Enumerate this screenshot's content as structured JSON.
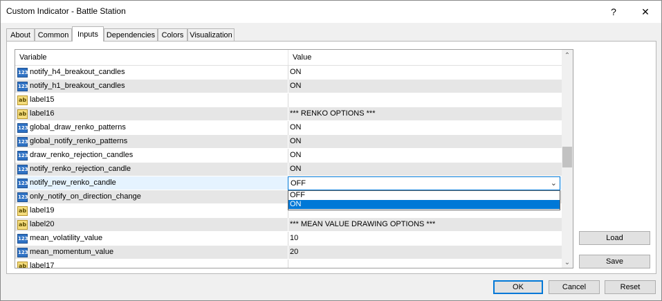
{
  "window": {
    "title": "Custom Indicator - Battle Station",
    "help_glyph": "?",
    "close_glyph": "✕"
  },
  "tabs": [
    "About",
    "Common",
    "Inputs",
    "Dependencies",
    "Colors",
    "Visualization"
  ],
  "grid": {
    "headers": {
      "variable": "Variable",
      "value": "Value"
    },
    "rows": [
      {
        "name": "notify_h4_breakout_candles",
        "value": "ON",
        "type": "123"
      },
      {
        "name": "notify_h1_breakout_candles",
        "value": "ON",
        "type": "123"
      },
      {
        "name": "label15",
        "value": "",
        "type": "ab"
      },
      {
        "name": "label16",
        "value": "*** RENKO OPTIONS ***",
        "type": "ab"
      },
      {
        "name": "global_draw_renko_patterns",
        "value": "ON",
        "type": "123"
      },
      {
        "name": "global_notify_renko_patterns",
        "value": "ON",
        "type": "123"
      },
      {
        "name": "draw_renko_rejection_candles",
        "value": "ON",
        "type": "123"
      },
      {
        "name": "notify_renko_rejection_candle",
        "value": "ON",
        "type": "123"
      },
      {
        "name": "notify_new_renko_candle",
        "value": "OFF",
        "type": "123"
      },
      {
        "name": "only_notify_on_direction_change",
        "value": "",
        "type": "123"
      },
      {
        "name": "label19",
        "value": "",
        "type": "ab"
      },
      {
        "name": "label20",
        "value": "*** MEAN VALUE DRAWING OPTIONS ***",
        "type": "ab"
      },
      {
        "name": "mean_volatility_value",
        "value": "10",
        "type": "123"
      },
      {
        "name": "mean_momentum_value",
        "value": "20",
        "type": "123"
      },
      {
        "name": "label17",
        "value": "",
        "type": "ab"
      }
    ],
    "scroll_up": "⌃",
    "scroll_down": "⌄"
  },
  "dropdown": {
    "selected": "OFF",
    "chevron": "⌄",
    "options": [
      "OFF",
      "ON"
    ],
    "highlighted": "ON"
  },
  "buttons": {
    "load": "Load",
    "save": "Save",
    "ok": "OK",
    "cancel": "Cancel",
    "reset": "Reset"
  },
  "colors": {
    "accent": "#0078d7",
    "row_alt": "#e6e6e6",
    "row_selected": "#e5f3ff"
  }
}
